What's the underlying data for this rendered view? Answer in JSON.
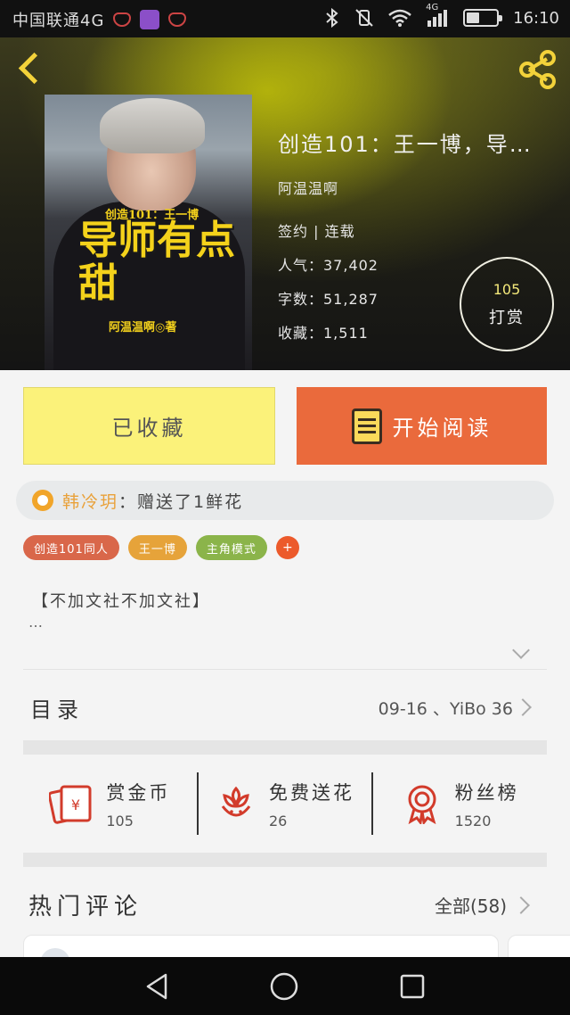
{
  "status_bar": {
    "carrier": "中国联通4G",
    "network_badge": "4G",
    "time": "16:10",
    "battery_level": 0.45,
    "icons": [
      "teacup-icon",
      "gallery-icon",
      "teacup-icon",
      "bluetooth-icon",
      "vibrate-off-icon",
      "wifi-icon",
      "signal-icon",
      "battery-icon"
    ]
  },
  "header": {
    "back_icon": "chevron-left-icon",
    "share_icon": "share-icon",
    "accent_color": "#f3d23a"
  },
  "cover": {
    "subtitle": "创造101：王一博",
    "title": "导师有点甜",
    "author": "阿温温啊◎著"
  },
  "book": {
    "title": "创造101：王一博，导…",
    "author": "阿温温啊",
    "status": "签约 | 连载",
    "popularity": "人气：37,402",
    "word_count": "字数：51,287",
    "favorites": "收藏：1,511",
    "tip_count": "105",
    "tip_label": "打赏"
  },
  "actions": {
    "collected_label": "已收藏",
    "read_label": "开始阅读",
    "collected_color": "#fbf27a",
    "read_color": "#ea6a3c"
  },
  "notice": {
    "user": "韩冷玥",
    "text": "：赠送了1鲜花"
  },
  "tags": [
    {
      "label": "创造101同人",
      "color": "#d9674a"
    },
    {
      "label": "王一博",
      "color": "#e6a33a"
    },
    {
      "label": "主角模式",
      "color": "#8bb44a"
    }
  ],
  "tag_more": "+",
  "description": {
    "text": "【不加文社不加文社】",
    "more": "…"
  },
  "toc": {
    "title": "目录",
    "latest": "09-16 、YiBo 36"
  },
  "stats": [
    {
      "label": "赏金币",
      "value": "105",
      "icon": "red-envelope-icon"
    },
    {
      "label": "免费送花",
      "value": "26",
      "icon": "flower-icon"
    },
    {
      "label": "粉丝榜",
      "value": "1520",
      "icon": "medal-icon"
    }
  ],
  "comments": {
    "title": "热门评论",
    "all_label": "全部(58)"
  },
  "nav": {
    "icons": [
      "back-triangle-icon",
      "home-circle-icon",
      "recent-square-icon"
    ]
  }
}
